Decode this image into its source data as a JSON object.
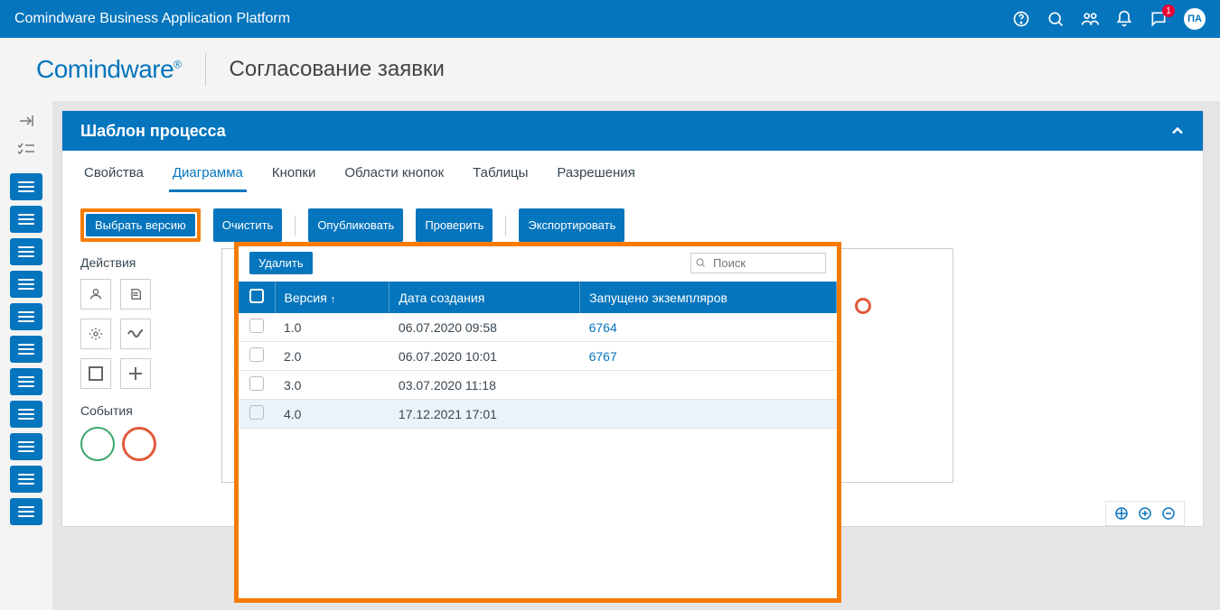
{
  "topbar": {
    "title": "Comindware Business Application Platform",
    "notif_count": "1",
    "avatar": "ПА"
  },
  "logo": "Comindware",
  "page_title": "Согласование заявки",
  "panel": {
    "title": "Шаблон процесса"
  },
  "tabs": [
    "Свойства",
    "Диаграмма",
    "Кнопки",
    "Области кнопок",
    "Таблицы",
    "Разрешения"
  ],
  "active_tab": 1,
  "toolbar": {
    "select_version": "Выбрать версию",
    "clear": "Очистить",
    "publish": "Опубликовать",
    "check": "Проверить",
    "export": "Экспортировать"
  },
  "left_panel": {
    "actions_label": "Действия",
    "events_label": "События"
  },
  "popup": {
    "delete_btn": "Удалить",
    "search_placeholder": "Поиск",
    "columns": {
      "version": "Версия",
      "created": "Дата создания",
      "instances": "Запущено экземпляров"
    },
    "rows": [
      {
        "version": "1.0",
        "created": "06.07.2020 09:58",
        "instances": "6764",
        "selected": false
      },
      {
        "version": "2.0",
        "created": "06.07.2020 10:01",
        "instances": "6767",
        "selected": false
      },
      {
        "version": "3.0",
        "created": "03.07.2020 11:18",
        "instances": "",
        "selected": false
      },
      {
        "version": "4.0",
        "created": "17.12.2021 17:01",
        "instances": "",
        "selected": true
      }
    ]
  }
}
